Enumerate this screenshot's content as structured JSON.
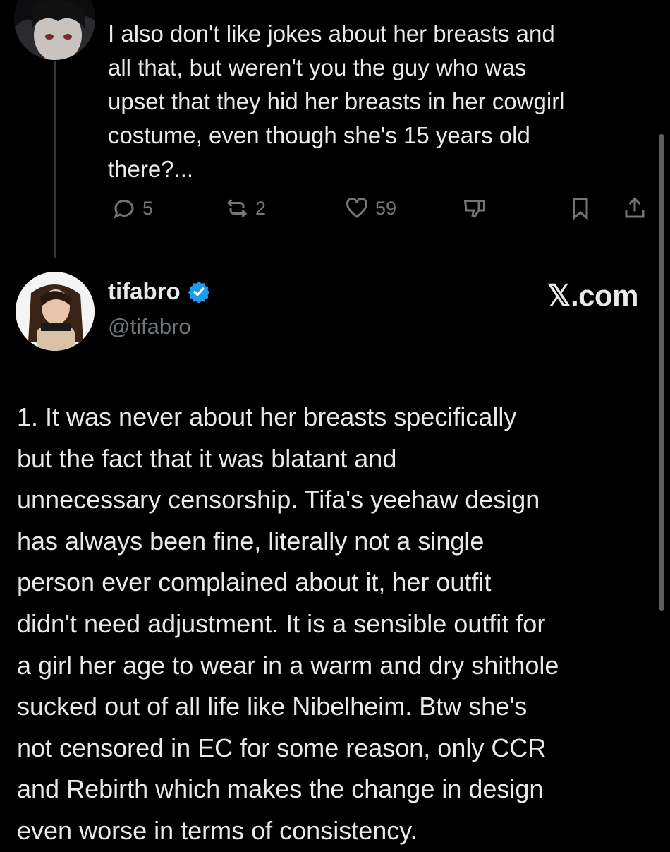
{
  "reply": {
    "text": "I also don't like jokes about her breasts and\nall that, but weren't you the guy who was\nupset that they hid her breasts in her cowgirl\ncostume, even though she's 15 years old\nthere?...",
    "replies": "5",
    "reposts": "2",
    "likes": "59"
  },
  "author": {
    "display_name": "tifabro",
    "handle": "@tifabro",
    "verified": true
  },
  "brand": "𝕏.com",
  "tweet": {
    "text": "1. It was never about her breasts specifically\nbut the fact that it was blatant and\nunnecessary censorship. Tifa's yeehaw design\nhas always been fine, literally not a single\nperson ever complained about it, her outfit\ndidn't need adjustment. It is a sensible outfit for\na girl her age to wear in a warm and dry shithole\nsucked out of all life like Nibelheim. Btw she's\nnot censored in EC for some reason, only CCR\nand Rebirth which makes the change in design\neven worse in terms of consistency."
  },
  "colors": {
    "background": "#000000",
    "text": "#e7e9ea",
    "muted": "#71767b",
    "verified": "#1d9bf0"
  },
  "icons": [
    "reply-icon",
    "repost-icon",
    "like-icon",
    "dislike-icon",
    "bookmark-icon",
    "share-icon",
    "verified-badge-icon"
  ]
}
